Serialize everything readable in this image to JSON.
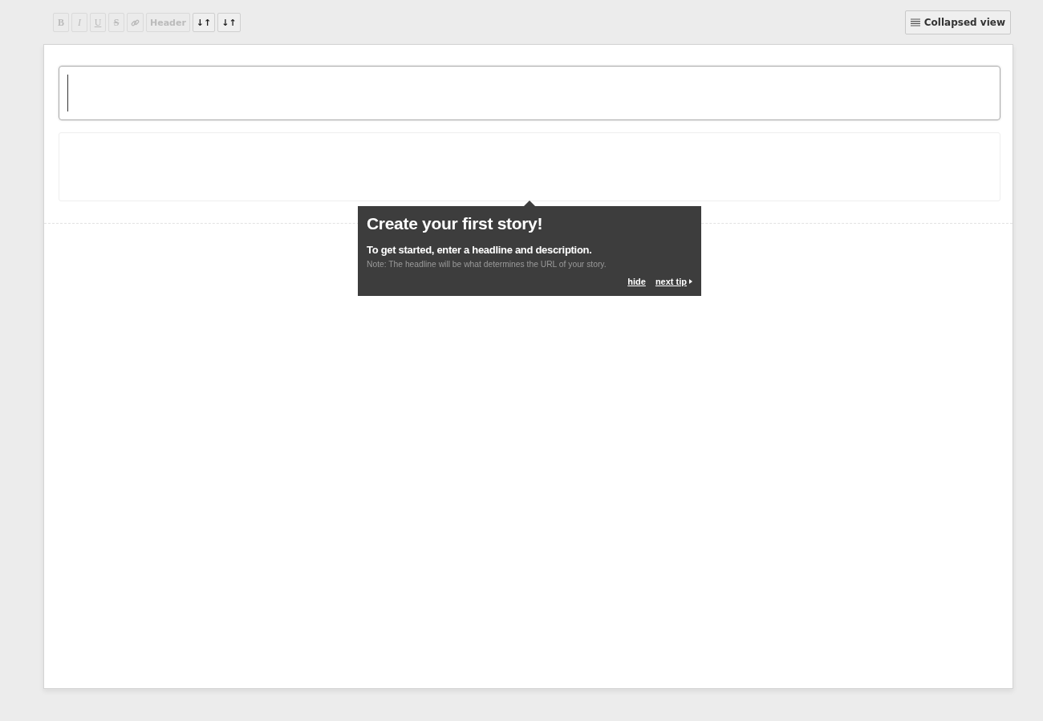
{
  "toolbar": {
    "buttons": [
      {
        "kind": "bold",
        "label": "B",
        "disabled": true
      },
      {
        "kind": "italic",
        "label": "I",
        "disabled": true
      },
      {
        "kind": "underline",
        "label": "U",
        "disabled": true
      },
      {
        "kind": "strike",
        "label": "S",
        "disabled": true
      },
      {
        "kind": "link",
        "disabled": true
      },
      {
        "kind": "text",
        "label": "Header",
        "disabled": true
      },
      {
        "kind": "text",
        "label": "↓↑",
        "disabled": false
      },
      {
        "kind": "text",
        "label": "↓↑",
        "disabled": false
      }
    ],
    "view_button": {
      "label": "Collapsed view"
    }
  },
  "editor": {
    "headline": {
      "focused": true
    }
  },
  "tooltip": {
    "title": "Create your first story!",
    "body": "To get started, enter a headline and description.",
    "note": "Note: The headline will be what determines the URL of your story.",
    "links": [
      {
        "kind": "link",
        "label": "hide"
      },
      {
        "kind": "next",
        "label": "next tip"
      }
    ]
  }
}
